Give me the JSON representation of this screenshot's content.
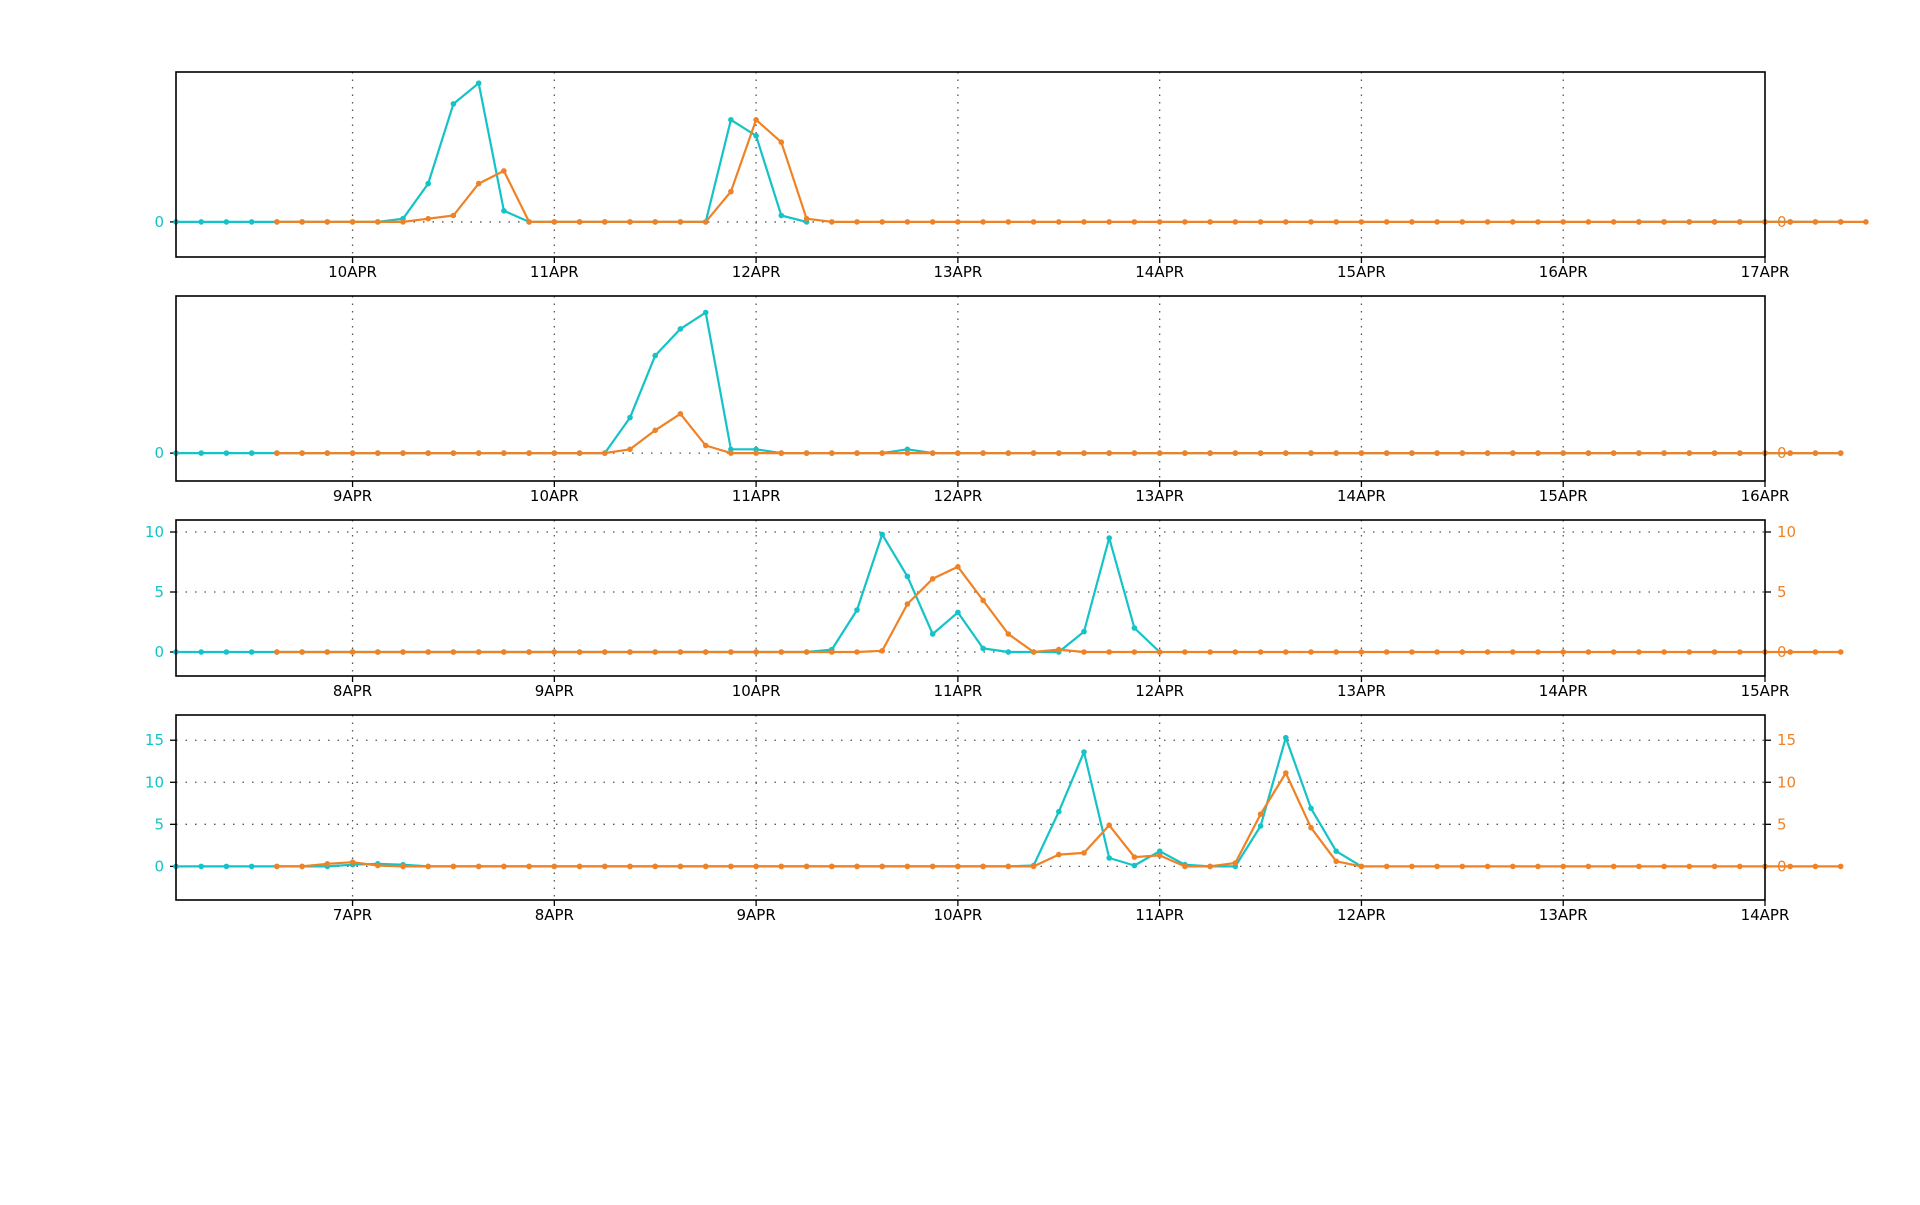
{
  "colors": {
    "series_a": "#14c3c8",
    "series_b": "#ef8226",
    "frame": "#000000",
    "grid": "#555555"
  },
  "chart_data": [
    {
      "type": "line",
      "title": "",
      "x_tick_labels": [
        "10APR",
        "11APR",
        "12APR",
        "13APR",
        "14APR",
        "15APR",
        "16APR",
        "17APR"
      ],
      "y_left_ticks": [
        0
      ],
      "y_right_ticks": [
        0
      ],
      "ylim": [
        -2.2,
        9.4
      ],
      "grid": true,
      "x_step_hours": 3,
      "series": [
        {
          "color": "#14c3c8",
          "start_index": 0,
          "values": [
            0,
            0,
            0,
            0,
            0,
            0,
            0,
            0,
            0,
            0.2,
            2.4,
            7.4,
            8.7,
            0.7,
            0,
            0,
            0,
            0,
            0,
            0,
            0,
            0,
            6.4,
            5.4,
            0.4,
            0
          ],
          "tail_start_index": 58,
          "tail_values": [
            0,
            0,
            0,
            0,
            0,
            0,
            0,
            0,
            0
          ]
        },
        {
          "color": "#ef8226",
          "start_index": 4,
          "values": [
            0,
            0,
            0,
            0,
            0,
            0,
            0.2,
            0.4,
            2.4,
            3.2,
            0,
            0,
            0,
            0,
            0,
            0,
            0,
            0,
            1.9,
            6.4,
            5.0,
            0.2,
            0,
            0,
            0,
            0,
            0,
            0,
            0,
            0,
            0,
            0,
            0,
            0,
            0,
            0,
            0,
            0,
            0,
            0,
            0,
            0,
            0,
            0,
            0,
            0,
            0,
            0,
            0,
            0,
            0,
            0,
            0,
            0,
            0,
            0,
            0,
            0,
            0,
            0,
            0,
            0,
            0,
            0
          ]
        }
      ]
    },
    {
      "type": "line",
      "title": "",
      "x_tick_labels": [
        "9APR",
        "10APR",
        "11APR",
        "12APR",
        "13APR",
        "14APR",
        "15APR",
        "16APR"
      ],
      "y_left_ticks": [
        0
      ],
      "y_right_ticks": [
        0
      ],
      "ylim": [
        -2.2,
        12.4
      ],
      "grid": true,
      "x_step_hours": 3,
      "series": [
        {
          "color": "#14c3c8",
          "start_index": 0,
          "values": [
            0,
            0,
            0,
            0,
            0,
            0,
            0,
            0,
            0,
            0,
            0,
            0,
            0,
            0,
            0,
            0,
            0,
            0,
            2.8,
            7.7,
            9.8,
            11.1,
            0.3,
            0.3,
            0,
            0,
            0,
            0,
            0,
            0.3,
            0,
            0,
            0,
            0,
            0,
            0,
            0,
            0,
            0,
            0,
            0,
            0,
            0,
            0,
            0,
            0,
            0,
            0,
            0,
            0,
            0,
            0,
            0,
            0,
            0,
            0,
            0,
            0,
            0,
            0,
            0,
            0,
            0,
            0,
            0,
            0,
            0
          ]
        },
        {
          "color": "#ef8226",
          "start_index": 4,
          "values": [
            0,
            0,
            0,
            0,
            0,
            0,
            0,
            0,
            0,
            0,
            0,
            0,
            0,
            0,
            0.3,
            1.8,
            3.1,
            0.6,
            0,
            0,
            0,
            0,
            0,
            0,
            0,
            0,
            0,
            0,
            0,
            0,
            0,
            0,
            0,
            0,
            0,
            0,
            0,
            0,
            0,
            0,
            0,
            0,
            0,
            0,
            0,
            0,
            0,
            0,
            0,
            0,
            0,
            0,
            0,
            0,
            0,
            0,
            0,
            0,
            0,
            0,
            0,
            0,
            0
          ]
        }
      ]
    },
    {
      "type": "line",
      "title": "",
      "x_tick_labels": [
        "8APR",
        "9APR",
        "10APR",
        "11APR",
        "12APR",
        "13APR",
        "14APR",
        "15APR"
      ],
      "y_left_ticks": [
        0,
        5,
        10
      ],
      "y_right_ticks": [
        0,
        5,
        10
      ],
      "ylim": [
        -2.0,
        11.0
      ],
      "grid": true,
      "x_step_hours": 3,
      "series": [
        {
          "color": "#14c3c8",
          "start_index": 0,
          "values": [
            0,
            0,
            0,
            0,
            0,
            0,
            0,
            0,
            0,
            0,
            0,
            0,
            0,
            0,
            0,
            0,
            0,
            0,
            0,
            0,
            0,
            0,
            0,
            0,
            0,
            0,
            0.2,
            3.5,
            9.8,
            6.3,
            1.5,
            3.3,
            0.3,
            0,
            0,
            0,
            1.7,
            9.5,
            2.0,
            0
          ]
        },
        {
          "color": "#ef8226",
          "start_index": 4,
          "values": [
            0,
            0,
            0,
            0,
            0,
            0,
            0,
            0,
            0,
            0,
            0,
            0,
            0,
            0,
            0,
            0,
            0,
            0,
            0,
            0,
            0,
            0,
            0,
            0,
            0.1,
            4.0,
            6.1,
            7.1,
            4.3,
            1.5,
            0,
            0.2,
            0,
            0,
            0,
            0,
            0,
            0,
            0,
            0,
            0,
            0,
            0,
            0,
            0,
            0,
            0,
            0,
            0,
            0,
            0,
            0,
            0,
            0,
            0,
            0,
            0,
            0,
            0,
            0,
            0,
            0,
            0
          ]
        }
      ]
    },
    {
      "type": "line",
      "title": "",
      "x_tick_labels": [
        "7APR",
        "8APR",
        "9APR",
        "10APR",
        "11APR",
        "12APR",
        "13APR",
        "14APR"
      ],
      "y_left_ticks": [
        0,
        5,
        10,
        15
      ],
      "y_right_ticks": [
        0,
        5,
        10,
        15
      ],
      "ylim": [
        -4.0,
        18.0
      ],
      "grid": true,
      "x_step_hours": 3,
      "series": [
        {
          "color": "#14c3c8",
          "start_index": 0,
          "values": [
            0,
            0,
            0,
            0,
            0,
            0,
            0,
            0.2,
            0.3,
            0.2,
            0,
            0,
            0,
            0,
            0,
            0,
            0,
            0,
            0,
            0,
            0,
            0,
            0,
            0,
            0,
            0,
            0,
            0,
            0,
            0,
            0,
            0,
            0,
            0,
            0.1,
            6.5,
            13.6,
            1.0,
            0.1,
            1.8,
            0.2,
            0,
            0,
            4.8,
            15.3,
            6.9,
            1.8,
            0
          ]
        },
        {
          "color": "#ef8226",
          "start_index": 4,
          "values": [
            0,
            0,
            0.3,
            0.5,
            0.1,
            0,
            0,
            0,
            0,
            0,
            0,
            0,
            0,
            0,
            0,
            0,
            0,
            0,
            0,
            0,
            0,
            0,
            0,
            0,
            0,
            0,
            0,
            0,
            0,
            0,
            0,
            1.4,
            1.6,
            4.9,
            1.1,
            1.3,
            0,
            0,
            0.4,
            6.2,
            11.1,
            4.6,
            0.6,
            0,
            0,
            0,
            0,
            0,
            0,
            0,
            0,
            0,
            0,
            0,
            0,
            0,
            0,
            0,
            0,
            0,
            0,
            0,
            0
          ]
        }
      ]
    }
  ]
}
